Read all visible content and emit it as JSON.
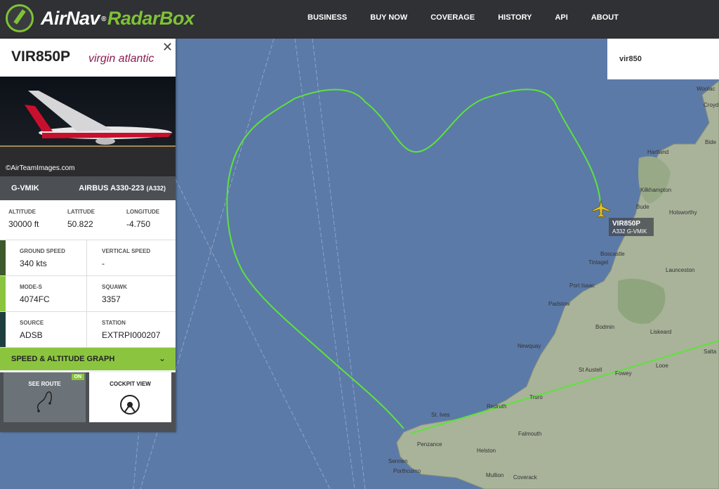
{
  "logo": {
    "brand_a": "AirNav",
    "brand_b": "RadarBox",
    "reg": "®"
  },
  "nav": [
    "BUSINESS",
    "BUY NOW",
    "COVERAGE",
    "HISTORY",
    "API",
    "ABOUT"
  ],
  "flight": {
    "callsign": "VIR850P",
    "airline_logo": "virgin atlantic",
    "photo_credit": "©AirTeamImages.com",
    "registration": "G-VMIK",
    "aircraft_type": "AIRBUS A330-223",
    "aircraft_code": "(A332)",
    "altitude_label": "ALTITUDE",
    "altitude": "30000 ft",
    "latitude_label": "LATITUDE",
    "latitude": "50.822",
    "longitude_label": "LONGITUDE",
    "longitude": "-4.750",
    "ground_speed_label": "GROUND SPEED",
    "ground_speed": "340 kts",
    "vertical_speed_label": "VERTICAL SPEED",
    "vertical_speed": "-",
    "modes_label": "MODE-S",
    "modes": "4074FC",
    "squawk_label": "SQUAWK",
    "squawk": "3357",
    "source_label": "SOURCE",
    "source": "ADSB",
    "station_label": "STATION",
    "station": "EXTRPI000207"
  },
  "graph_bar": "SPEED & ALTITUDE GRAPH",
  "buttons": {
    "route": "SEE ROUTE",
    "route_badge": "ON",
    "cockpit": "COCKPIT VIEW"
  },
  "search": {
    "value": "vir850"
  },
  "map_tag": {
    "callsign": "VIR850P",
    "info": "A332  G-VMIK"
  },
  "towns": [
    "Woolac",
    "Croyd",
    "Bide",
    "Hartland",
    "Kilkhampton",
    "Bude",
    "Holsworthy",
    "Boscastle",
    "Tintagel",
    "Launceston",
    "Port Isaac",
    "Padstow",
    "Bodmin",
    "Liskeard",
    "Newquay",
    "St Austell",
    "Fowey",
    "Looe",
    "Salta",
    "St. Ives",
    "Redruth",
    "Truro",
    "Falmouth",
    "Penzance",
    "Helston",
    "Sennen",
    "Porthcurno",
    "Mullion",
    "Coverack"
  ],
  "colors": {
    "accent": "#8bc53f",
    "topbar": "#2f3134",
    "sea": "#5b7aa8",
    "track": "#5de33a"
  }
}
